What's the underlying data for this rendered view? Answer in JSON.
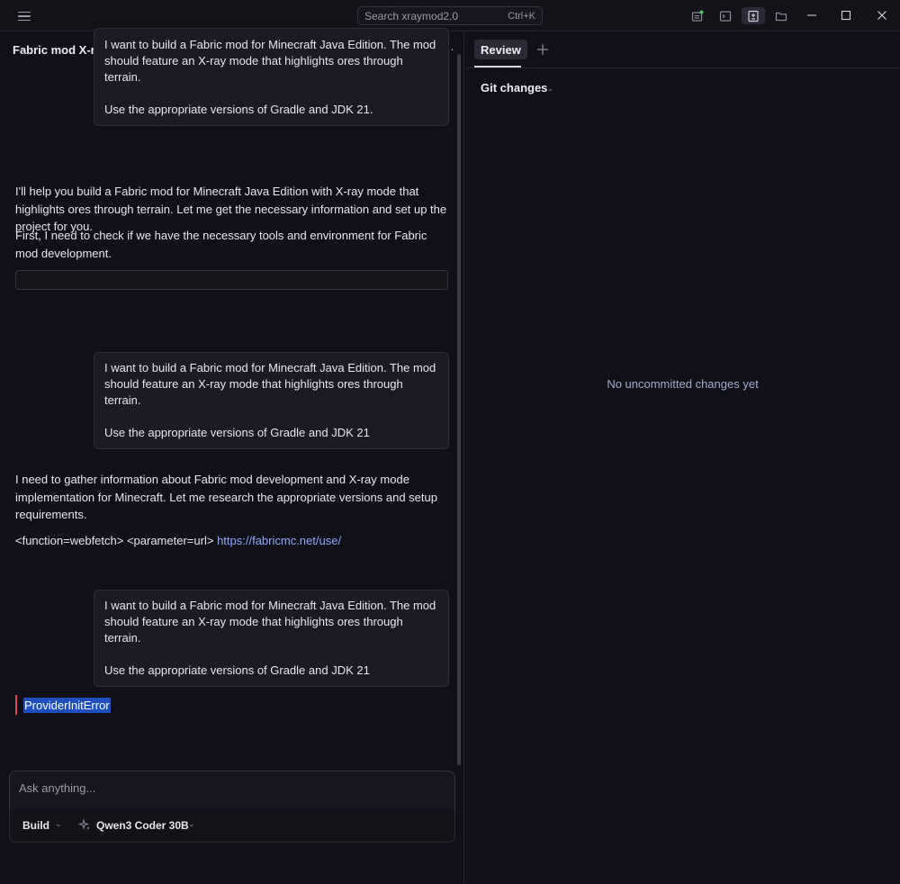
{
  "titlebar": {
    "search_placeholder": "Search xraymod2.0",
    "search_shortcut": "Ctrl+K"
  },
  "chat": {
    "title": "Fabric mod X-ray ores through terrain highlighting",
    "messages": [
      {
        "role": "user",
        "line1": "I want to build a Fabric mod for Minecraft Java Edition. The mod",
        "line2": "should feature an X-ray mode that highlights ores through terrain.",
        "line3": "Use the appropriate versions of Gradle and JDK 21."
      },
      {
        "role": "assistant",
        "para1": "I'll help you build a Fabric mod for Minecraft Java Edition with X-ray mode that highlights ores through terrain. Let me get the necessary information and set up the project for you.",
        "para2": "First, I need to check if we have the necessary tools and environment for Fabric mod development."
      },
      {
        "role": "user",
        "line1": "I want to build a Fabric mod for Minecraft Java Edition. The mod",
        "line2": "should feature an X-ray mode that highlights ores through terrain.",
        "line3": "Use the appropriate versions of Gradle and JDK 21"
      },
      {
        "role": "assistant",
        "para1": "I need to gather information about Fabric mod development and X-ray mode implementation for Minecraft. Let me research the appropriate versions and setup requirements.",
        "code_prefix": "<function=webfetch> <parameter=url>",
        "link": "https://fabricmc.net/use/"
      },
      {
        "role": "user",
        "line1": "I want to build a Fabric mod for Minecraft Java Edition. The mod",
        "line2": "should feature an X-ray mode that highlights ores through terrain.",
        "line3": "Use the appropriate versions of Gradle and JDK 21"
      }
    ],
    "error": "ProviderInitError"
  },
  "composer": {
    "placeholder": "Ask anything...",
    "mode": "Build",
    "model": "Qwen3 Coder 30B"
  },
  "review": {
    "tab_label": "Review",
    "section_label": "Git changes",
    "empty_state": "No uncommitted changes yet"
  },
  "colors": {
    "background": "#101018",
    "bubble": "#1b1b24",
    "link": "#8fa8ff",
    "error_bar": "#e0455a",
    "selection": "#1f4fbf"
  }
}
